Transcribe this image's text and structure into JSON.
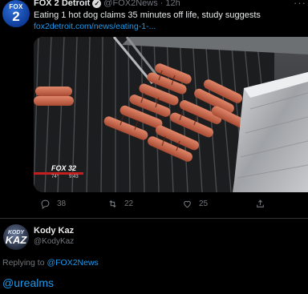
{
  "tweet": {
    "avatar": {
      "line1": "FOX",
      "line2": "2"
    },
    "author_name": "FOX 2 Detroit",
    "handle": "@FOX2News",
    "separator": "·",
    "time": "12h",
    "more": "···",
    "text": "Eating 1 hot dog claims 35 minutes off life, study suggests",
    "link": "fox2detroit.com/news/eating-1-..."
  },
  "media": {
    "broadcast": {
      "station": "FOX 32",
      "temp": "74°",
      "time": "9:43"
    }
  },
  "actions": {
    "reply_count": "38",
    "retweet_count": "22",
    "like_count": "25"
  },
  "reply": {
    "avatar": {
      "line1": "KODY",
      "line2": "KAZ"
    },
    "name": "Kody Kaz",
    "handle": "@KodyKaz",
    "replying_prefix": "Replying to",
    "replying_to": "@FOX2News",
    "body": "@urealms"
  },
  "colors": {
    "background": "#000000",
    "text": "#e7e9ea",
    "secondary": "#71767b",
    "link": "#1d9bf0",
    "divider": "#2f3336"
  }
}
